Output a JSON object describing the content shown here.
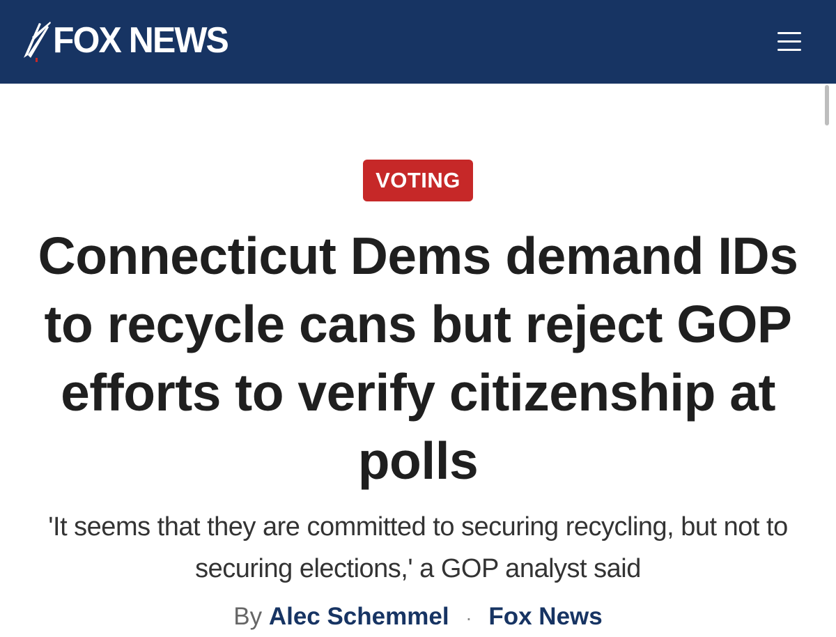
{
  "header": {
    "logo_text": "FOX NEWS",
    "logo_icon": "fox-news-searchlight-icon",
    "menu_icon": "hamburger-menu-icon",
    "background_color": "#173463"
  },
  "article": {
    "category": "VOTING",
    "category_color": "#c62828",
    "headline": "Connecticut Dems demand IDs to recycle cans but reject GOP efforts to verify citizenship at polls",
    "subheadline": "'It seems that they are committed to securing recycling, but not to securing elections,' a GOP analyst said",
    "byline": {
      "prefix": "By",
      "author": "Alec Schemmel",
      "separator": "·",
      "outlet": "Fox News"
    }
  }
}
